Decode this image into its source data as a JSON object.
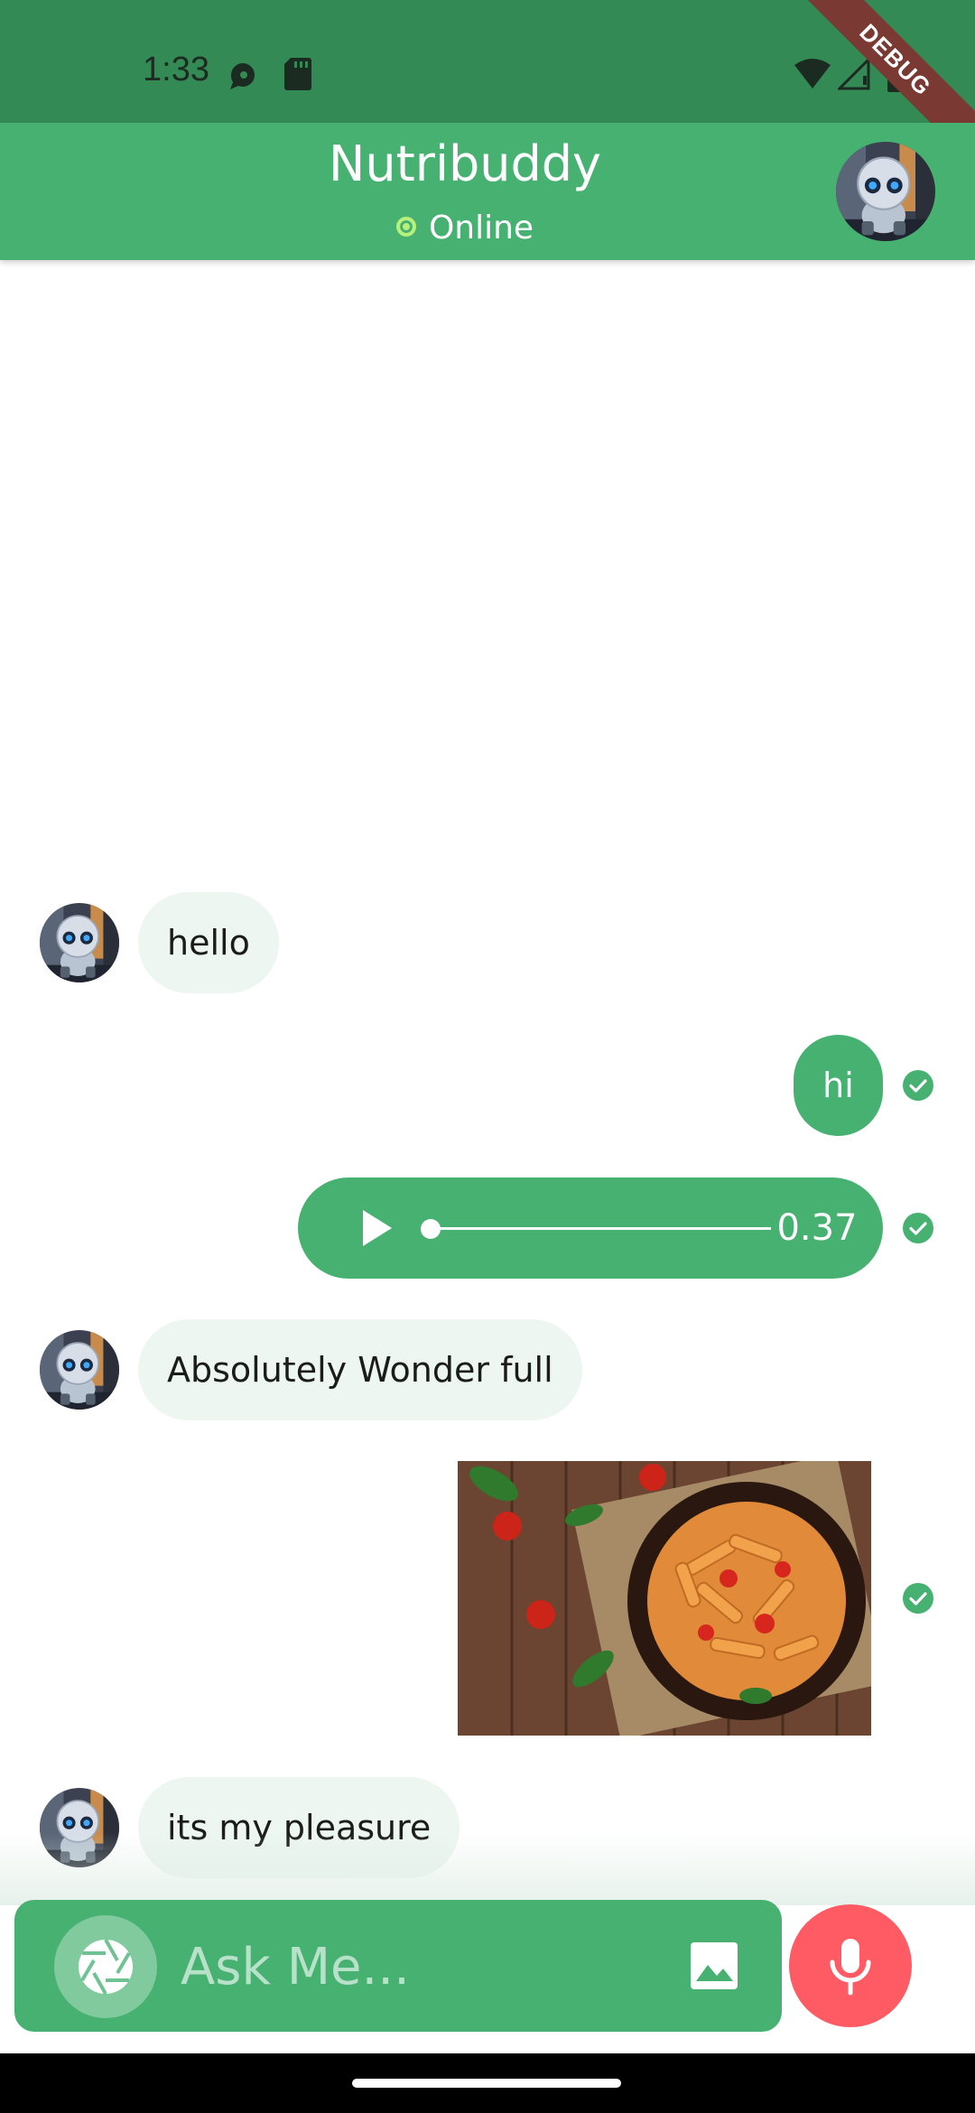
{
  "status_bar": {
    "time": "1:33",
    "debug_label": "DEBUG",
    "icons": [
      "notification-icon",
      "sd-card-icon",
      "wifi-icon",
      "signal-icon",
      "battery-icon"
    ]
  },
  "header": {
    "title": "Nutribuddy",
    "status": "Online",
    "avatar_icon": "robot-avatar"
  },
  "messages": [
    {
      "from": "bot",
      "type": "text",
      "text": "hello"
    },
    {
      "from": "user",
      "type": "text",
      "text": "hi",
      "status": "sent-check"
    },
    {
      "from": "user",
      "type": "audio",
      "duration": "0.37",
      "status": "sent-check"
    },
    {
      "from": "bot",
      "type": "text",
      "text": "Absolutely Wonder full"
    },
    {
      "from": "user",
      "type": "image",
      "image_description": "pasta-dish-image",
      "status": "sent-check"
    },
    {
      "from": "bot",
      "type": "text",
      "text": "its my pleasure"
    }
  ],
  "input": {
    "placeholder": "Ask Me...",
    "camera_icon": "camera-aperture-icon",
    "gallery_icon": "image-icon",
    "mic_icon": "mic-icon"
  },
  "colors": {
    "primary": "#46b171",
    "status_bar": "#348a55",
    "incoming_bubble": "#edf6f1",
    "mic_button": "#fe5b64",
    "online_dot": "#b7f07c"
  }
}
